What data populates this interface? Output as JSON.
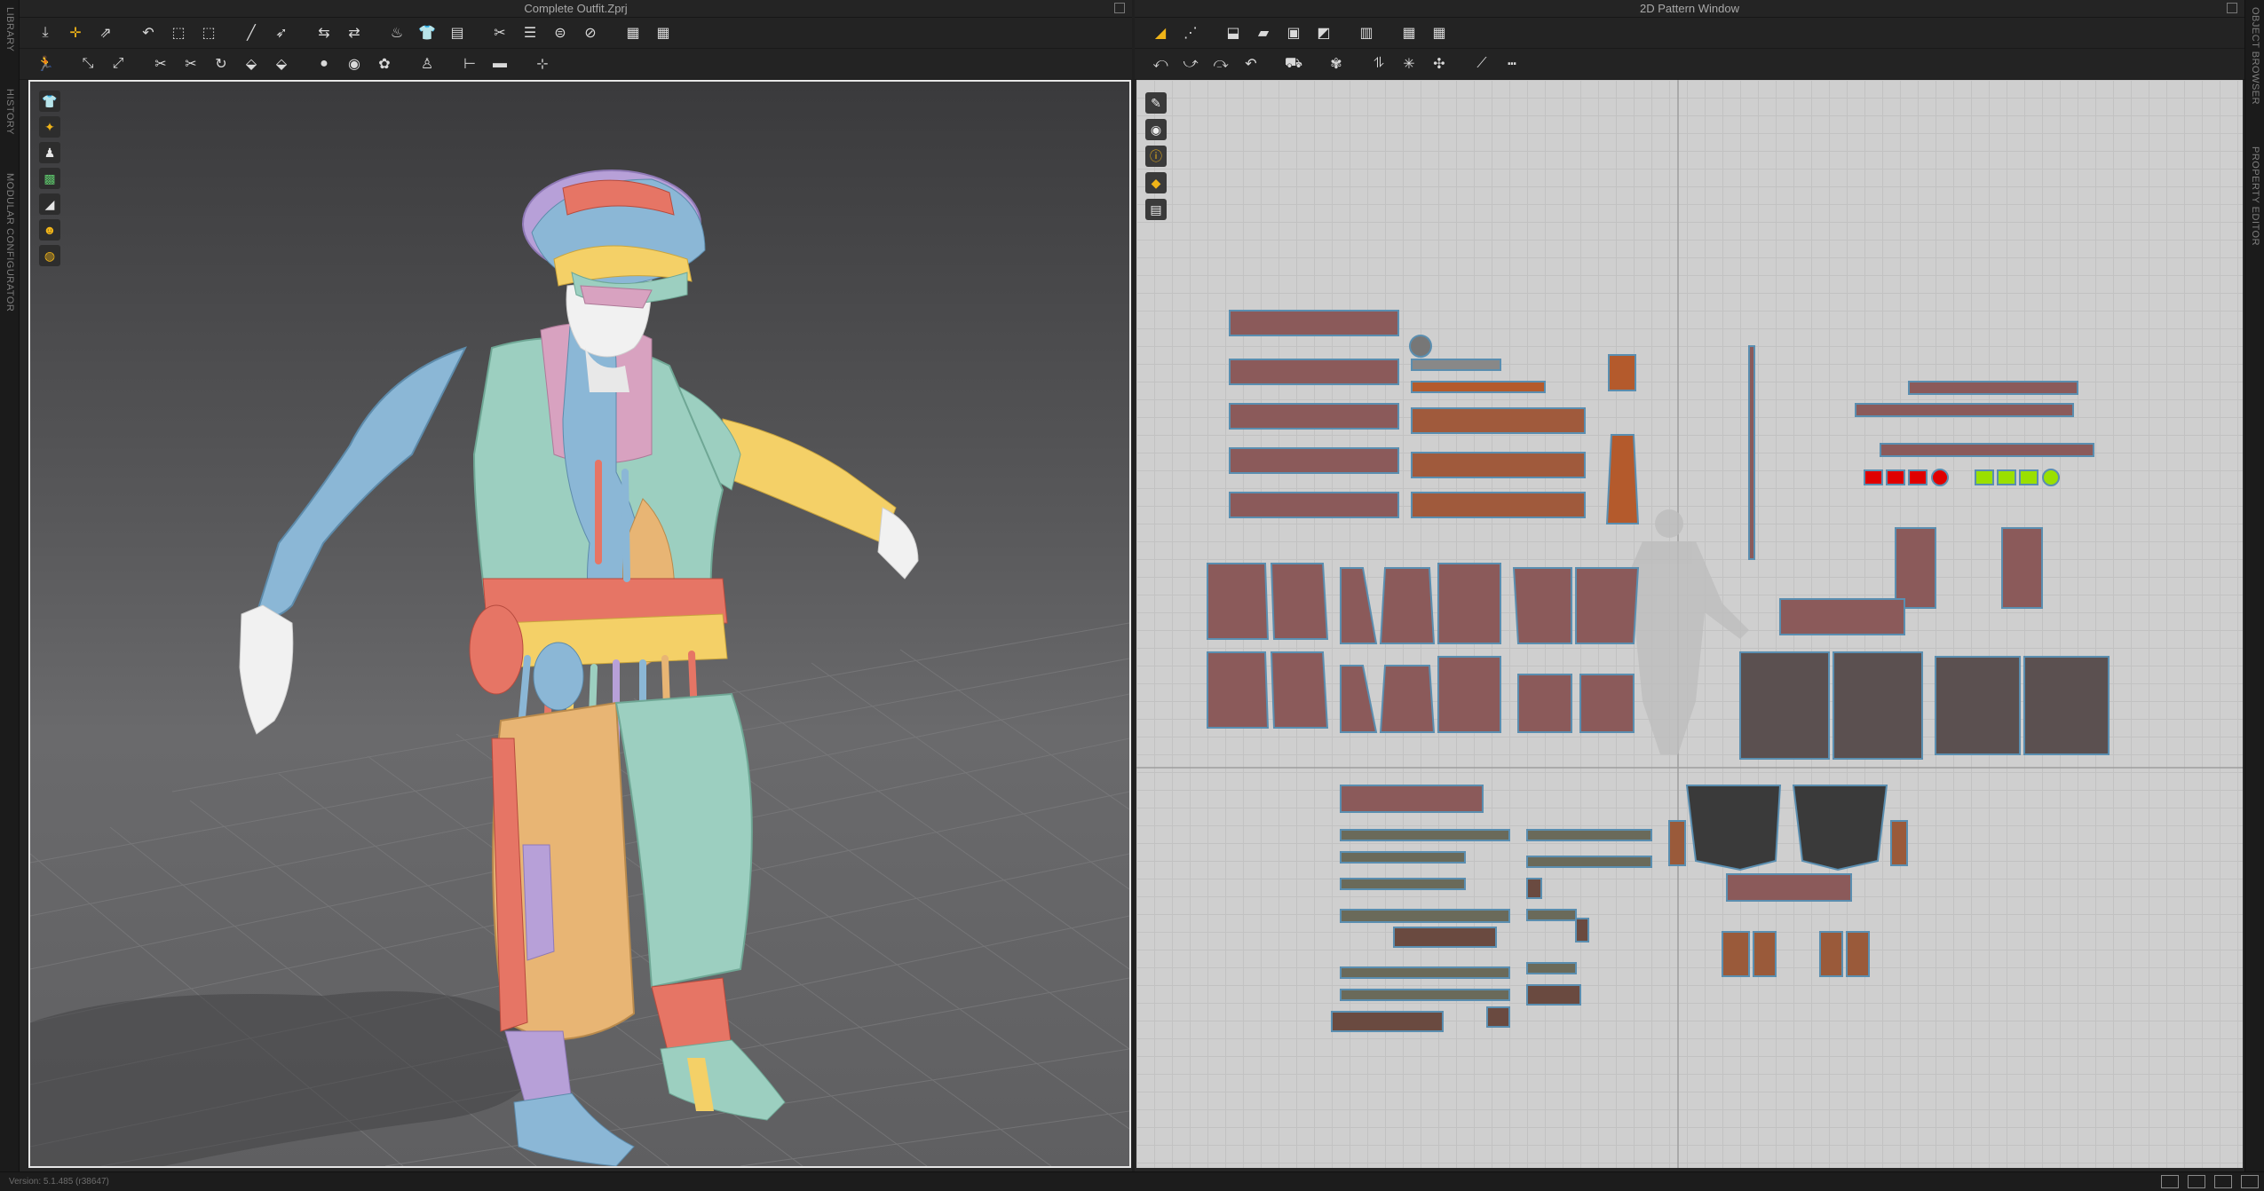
{
  "left_window": {
    "title": "Complete Outfit.Zprj"
  },
  "right_window": {
    "title": "2D Pattern Window"
  },
  "left_rail_tabs": [
    "LIBRARY",
    "HISTORY",
    "MODULAR CONFIGURATOR"
  ],
  "right_rail_tabs": [
    "OBJECT BROWSER",
    "PROPERTY EDITOR"
  ],
  "status": {
    "version": "Version: 5.1.485 (r38647)"
  },
  "icons": {
    "viewport_tools": [
      "garment-display-icon",
      "texture-display-icon",
      "avatar-display-icon",
      "color-map-icon",
      "surface-icon",
      "avatar-skin-icon",
      "globe-icon"
    ],
    "pattern_tools": [
      "ruler-icon",
      "eye-icon",
      "info-icon",
      "fabric-icon",
      "layer-icon"
    ]
  },
  "colors": {
    "accent": "#f0b418",
    "pattern_fill": "#8b5a5a",
    "pattern_background": "#cfcfcf"
  }
}
